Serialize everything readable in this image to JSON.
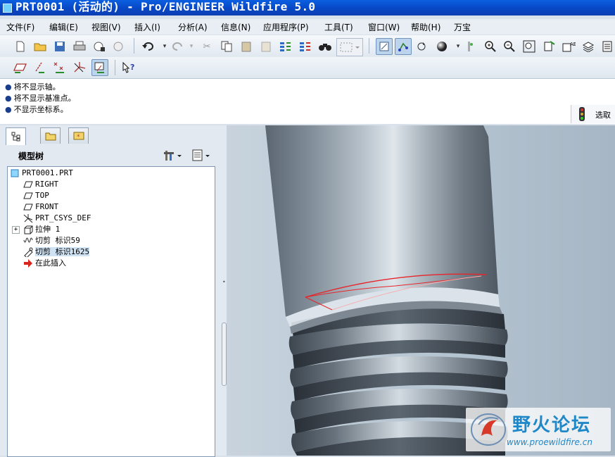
{
  "window": {
    "title": "PRT0001 (活动的) - Pro/ENGINEER Wildfire 5.0"
  },
  "menu": [
    "文件(F)",
    "编辑(E)",
    "视图(V)",
    "插入(I)",
    "分析(A)",
    "信息(N)",
    "应用程序(P)",
    "工具(T)",
    "窗口(W)",
    "帮助(H)",
    "万宝"
  ],
  "messages": [
    "将不显示轴。",
    "将不显示基准点。",
    "不显示坐标系。"
  ],
  "selection": {
    "label": "选取"
  },
  "model_tree": {
    "title": "模型树",
    "items": [
      {
        "label": "PRT0001.PRT",
        "icon": "part-icon"
      },
      {
        "label": "RIGHT",
        "icon": "datum-plane-icon"
      },
      {
        "label": "TOP",
        "icon": "datum-plane-icon"
      },
      {
        "label": "FRONT",
        "icon": "datum-plane-icon"
      },
      {
        "label": "PRT_CSYS_DEF",
        "icon": "csys-icon"
      },
      {
        "label": "拉伸 1",
        "icon": "extrude-icon"
      },
      {
        "label": "切剪 标识59",
        "icon": "helical-cut-icon"
      },
      {
        "label": "切剪 标识1625",
        "icon": "cut-icon"
      },
      {
        "label": "在此插入",
        "icon": "insert-arrow-icon"
      }
    ]
  },
  "watermark": {
    "title": "野火论坛",
    "url": "www.proewildfire.cn"
  },
  "colors": {
    "titlebar": "#0a5fe0",
    "viewport_bg": "#b7c6d3",
    "part_body": "#7f8c98",
    "edge_highlight": "#e8242a"
  }
}
